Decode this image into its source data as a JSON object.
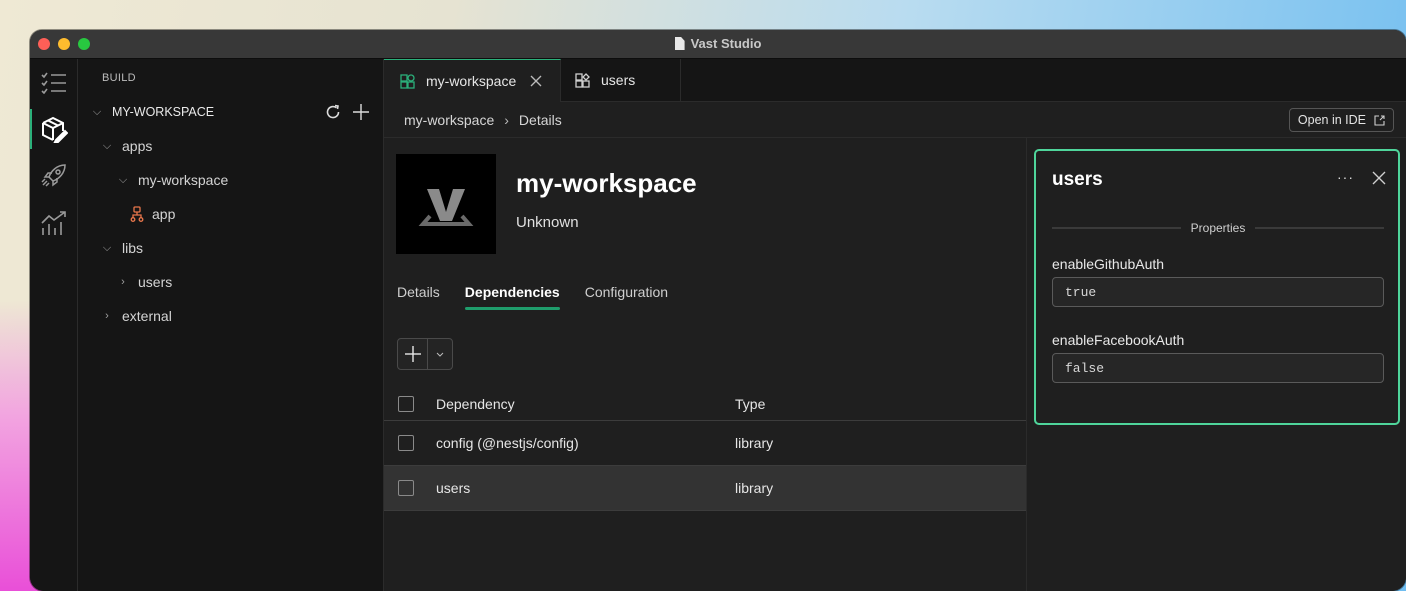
{
  "window": {
    "title": "Vast Studio"
  },
  "activity_bar": {
    "items": [
      {
        "name": "tasks",
        "icon": "checklist-icon",
        "active": false
      },
      {
        "name": "build",
        "icon": "package-edit-icon",
        "active": true
      },
      {
        "name": "deploy",
        "icon": "rocket-icon",
        "active": false
      },
      {
        "name": "analytics",
        "icon": "chart-icon",
        "active": false
      }
    ]
  },
  "explorer": {
    "section_title": "BUILD",
    "workspace": "MY-WORKSPACE",
    "tree": [
      {
        "label": "apps",
        "level": 1,
        "expanded": true
      },
      {
        "label": "my-workspace",
        "level": 2,
        "expanded": true
      },
      {
        "label": "app",
        "level": 3,
        "icon": "app-component-icon"
      },
      {
        "label": "libs",
        "level": 1,
        "expanded": true
      },
      {
        "label": "users",
        "level": 2,
        "expanded": false
      },
      {
        "label": "external",
        "level": 1,
        "expanded": false
      }
    ]
  },
  "tabs": [
    {
      "label": "my-workspace",
      "active": true,
      "closable": true
    },
    {
      "label": "users",
      "active": false
    }
  ],
  "breadcrumb": [
    "my-workspace",
    "Details"
  ],
  "open_ide_label": "Open in IDE",
  "project": {
    "logo_letter": "V",
    "title": "my-workspace",
    "subtitle": "Unknown"
  },
  "subtabs": [
    {
      "label": "Details",
      "active": false
    },
    {
      "label": "Dependencies",
      "active": true
    },
    {
      "label": "Configuration",
      "active": false
    }
  ],
  "dependencies_table": {
    "columns": [
      "Dependency",
      "Type"
    ],
    "rows": [
      {
        "dependency": "config (@nestjs/config)",
        "type": "library",
        "selected": false
      },
      {
        "dependency": "users",
        "type": "library",
        "selected": true
      }
    ]
  },
  "properties_panel": {
    "title": "users",
    "section": "Properties",
    "properties": [
      {
        "label": "enableGithubAuth",
        "value": "true"
      },
      {
        "label": "enableFacebookAuth",
        "value": "false"
      }
    ]
  },
  "colors": {
    "accent": "#2bb07a",
    "panel_border": "#4fd59b",
    "app_icon": "#e8764b"
  }
}
